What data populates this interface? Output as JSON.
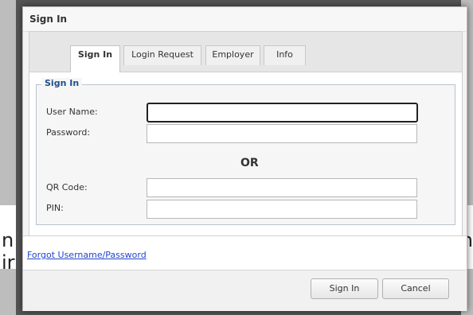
{
  "background": {
    "left_text_1": "n",
    "left_text_2": "ir",
    "right_text": "n"
  },
  "dialog": {
    "title": "Sign In",
    "tabs": [
      {
        "label": "Sign In",
        "active": true
      },
      {
        "label": "Login Request",
        "active": false
      },
      {
        "label": "Employer",
        "active": false
      },
      {
        "label": "Info",
        "active": false
      }
    ],
    "form": {
      "legend": "Sign In",
      "user_name_label": "User Name:",
      "user_name_value": "",
      "password_label": "Password:",
      "password_value": "",
      "or_text": "OR",
      "qr_code_label": "QR Code:",
      "qr_code_value": "",
      "pin_label": "PIN:",
      "pin_value": ""
    },
    "forgot_link": "Forgot Username/Password",
    "buttons": {
      "sign_in": "Sign In",
      "cancel": "Cancel"
    }
  },
  "colors": {
    "link": "#2345cc",
    "legend": "#1f4e8c",
    "overlay": "#555555"
  }
}
